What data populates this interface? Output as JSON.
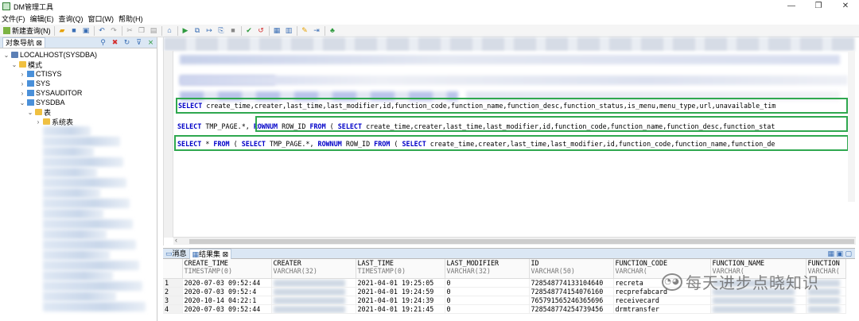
{
  "window": {
    "title": "DM管理工具",
    "controls": [
      "—",
      "❐",
      "✕"
    ]
  },
  "menu": [
    "文件(F)",
    "编辑(E)",
    "查询(Q)",
    "窗口(W)",
    "帮助(H)"
  ],
  "toolbar": {
    "new_query": "新建查询(N)"
  },
  "nav": {
    "tab_label": "对象导航",
    "tree": [
      {
        "label": "LOCALHOST(SYSDBA)",
        "depth": 0,
        "expanded": true,
        "icon": "server-icon"
      },
      {
        "label": "模式",
        "depth": 1,
        "expanded": true,
        "icon": "folder-icon"
      },
      {
        "label": "CTISYS",
        "depth": 2,
        "expanded": false,
        "icon": "schema-icon"
      },
      {
        "label": "SYS",
        "depth": 2,
        "expanded": false,
        "icon": "schema-icon"
      },
      {
        "label": "SYSAUDITOR",
        "depth": 2,
        "expanded": false,
        "icon": "schema-icon"
      },
      {
        "label": "SYSDBA",
        "depth": 2,
        "expanded": true,
        "icon": "schema-icon"
      },
      {
        "label": "表",
        "depth": 3,
        "expanded": true,
        "icon": "folder-icon"
      },
      {
        "label": "系统表",
        "depth": 4,
        "expanded": false,
        "icon": "folder-icon"
      }
    ]
  },
  "editor": {
    "sql_lines": [
      "SELECT create_time,creater,last_time,last_modifier,id,function_code,function_name,function_desc,function_status,is_menu,menu_type,url,unavailable_tim",
      "SELECT TMP_PAGE.*, ROWNUM ROW_ID FROM ( SELECT create_time,creater,last_time,last_modifier,id,function_code,function_name,function_desc,function_stat",
      "SELECT * FROM ( SELECT TMP_PAGE.*, ROWNUM ROW_ID FROM ( SELECT create_time,creater,last_time,last_modifier,id,function_code,function_name,function_de"
    ]
  },
  "results": {
    "tabs": [
      "消息",
      "结果集"
    ],
    "columns": [
      {
        "name": "CREATE_TIME",
        "type": "TIMESTAMP(0)"
      },
      {
        "name": "CREATER",
        "type": "VARCHAR(32)"
      },
      {
        "name": "LAST_TIME",
        "type": "TIMESTAMP(0)"
      },
      {
        "name": "LAST_MODIFIER",
        "type": "VARCHAR(32)"
      },
      {
        "name": "ID",
        "type": "VARCHAR(50)"
      },
      {
        "name": "FUNCTION_CODE",
        "type": "VARCHAR("
      },
      {
        "name": "FUNCTION_NAME",
        "type": "VARCHAR("
      },
      {
        "name": "FUNCTION",
        "type": "VARCHAR("
      }
    ],
    "rows": [
      [
        "1",
        "2020-07-03 09:52:44",
        "",
        "2021-04-01 19:25:05",
        "0",
        "728548774133104640",
        "recreta",
        "",
        ""
      ],
      [
        "2",
        "2020-07-03 09:52:4",
        "",
        "2021-04-01 19:24:59",
        "0",
        "728548774154076160",
        "recprefabcard",
        "",
        ""
      ],
      [
        "3",
        "2020-10-14 04:22:1",
        "",
        "2021-04-01 19:24:39",
        "0",
        "765791565246365696",
        "receivecard",
        "",
        ""
      ],
      [
        "4",
        "2020-07-03 09:52:44",
        "",
        "2021-04-01 19:21:45",
        "0",
        "728548774254739456",
        "drmtransfer",
        "",
        ""
      ]
    ]
  },
  "watermark": "每天进步点晓知识"
}
